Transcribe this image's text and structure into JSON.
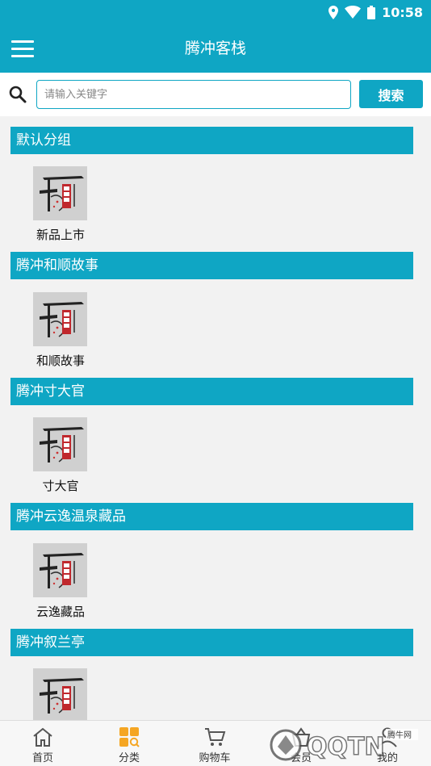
{
  "status_bar": {
    "time": "10:58"
  },
  "app_bar": {
    "title": "腾冲客栈"
  },
  "search": {
    "placeholder": "请输入关键字",
    "button_label": "搜索"
  },
  "groups": [
    {
      "title": "默认分组",
      "item_label": "新品上市"
    },
    {
      "title": "腾冲和顺故事",
      "item_label": "和顺故事"
    },
    {
      "title": "腾冲寸大官",
      "item_label": "寸大官"
    },
    {
      "title": "腾冲云逸温泉藏品",
      "item_label": "云逸藏品"
    },
    {
      "title": "腾冲叙兰亭",
      "item_label": ""
    }
  ],
  "tabs": [
    {
      "label": "首页",
      "icon": "home-icon"
    },
    {
      "label": "分类",
      "icon": "category-icon"
    },
    {
      "label": "购物车",
      "icon": "cart-icon"
    },
    {
      "label": "会员",
      "icon": "basket-icon"
    },
    {
      "label": "我的",
      "icon": "user-icon"
    }
  ],
  "colors": {
    "primary": "#0fa6c4",
    "active_tab": "#f5a623"
  },
  "watermark": {
    "brand": "QQTN",
    "site": "腾牛网"
  }
}
